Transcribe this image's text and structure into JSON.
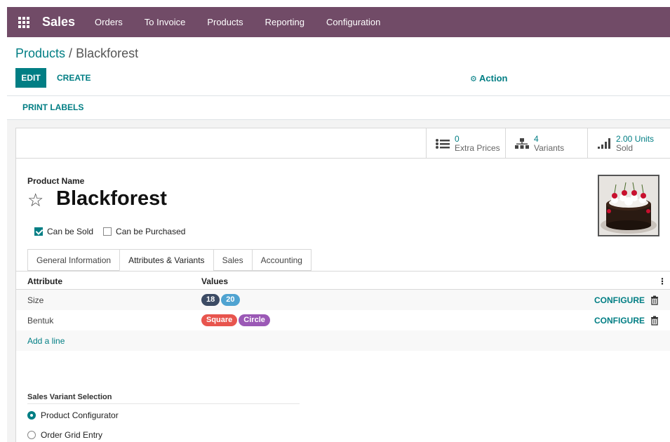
{
  "navbar": {
    "brand": "Sales",
    "menu": [
      "Orders",
      "To Invoice",
      "Products",
      "Reporting",
      "Configuration"
    ]
  },
  "breadcrumb": {
    "parent": "Products",
    "separator": " / ",
    "current": "Blackforest"
  },
  "controls": {
    "edit": "EDIT",
    "create": "CREATE",
    "action": "Action",
    "print_labels": "PRINT LABELS"
  },
  "stats": [
    {
      "value": "0",
      "label": "Extra Prices",
      "icon": "list-icon"
    },
    {
      "value": "4",
      "label": "Variants",
      "icon": "sitemap-icon"
    },
    {
      "value": "2.00 Units",
      "label": "Sold",
      "icon": "signal-icon"
    }
  ],
  "product": {
    "name_label": "Product Name",
    "name": "Blackforest",
    "can_be_sold_label": "Can be Sold",
    "can_be_sold": true,
    "can_be_purchased_label": "Can be Purchased",
    "can_be_purchased": false
  },
  "tabs": [
    "General Information",
    "Attributes & Variants",
    "Sales",
    "Accounting"
  ],
  "active_tab": "Attributes & Variants",
  "table": {
    "headers": {
      "attribute": "Attribute",
      "values": "Values"
    },
    "rows": [
      {
        "attribute": "Size",
        "values": [
          {
            "label": "18",
            "color": "#3c4b64"
          },
          {
            "label": "20",
            "color": "#4fa3d1"
          }
        ],
        "action": "CONFIGURE"
      },
      {
        "attribute": "Bentuk",
        "values": [
          {
            "label": "Square",
            "color": "#e8554e"
          },
          {
            "label": "Circle",
            "color": "#9b59b6"
          }
        ],
        "action": "CONFIGURE"
      }
    ],
    "add_line": "Add a line"
  },
  "variant_selection": {
    "title": "Sales Variant Selection",
    "options": [
      {
        "label": "Product Configurator",
        "selected": true
      },
      {
        "label": "Order Grid Entry",
        "selected": false
      }
    ]
  },
  "colors": {
    "brand": "#714b67",
    "accent": "#017e84"
  }
}
